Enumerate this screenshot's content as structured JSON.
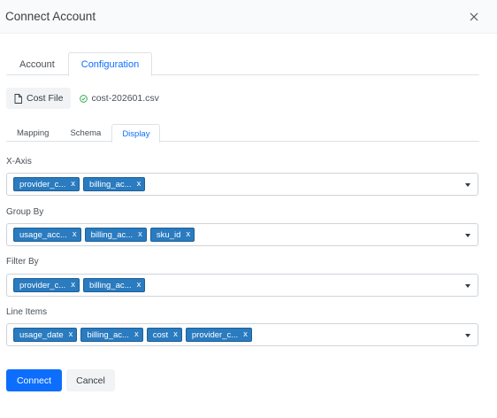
{
  "modal": {
    "title": "Connect Account"
  },
  "tabs": [
    "Account",
    "Configuration"
  ],
  "active_tab": "Configuration",
  "file": {
    "button_label": "Cost File",
    "filename": "cost-202601.csv",
    "status": "uploaded"
  },
  "subtabs": [
    "Mapping",
    "Schema",
    "Display"
  ],
  "active_subtab": "Display",
  "fields": {
    "x_axis": {
      "label": "X-Axis",
      "selected": [
        "provider_c...",
        "billing_ac..."
      ]
    },
    "group_by": {
      "label": "Group By",
      "selected": [
        "usage_acc...",
        "billing_ac...",
        "sku_id"
      ]
    },
    "filter_by": {
      "label": "Filter By",
      "selected": [
        "provider_c...",
        "billing_ac..."
      ]
    },
    "line_items": {
      "label": "Line Items",
      "selected": [
        "usage_date",
        "billing_ac...",
        "cost",
        "provider_c..."
      ]
    }
  },
  "chip_remove_label": "x",
  "buttons": {
    "connect": "Connect",
    "cancel": "Cancel"
  },
  "colors": {
    "primary": "#0d6efd",
    "chip": "#2a7bbf",
    "success": "#28a745"
  }
}
